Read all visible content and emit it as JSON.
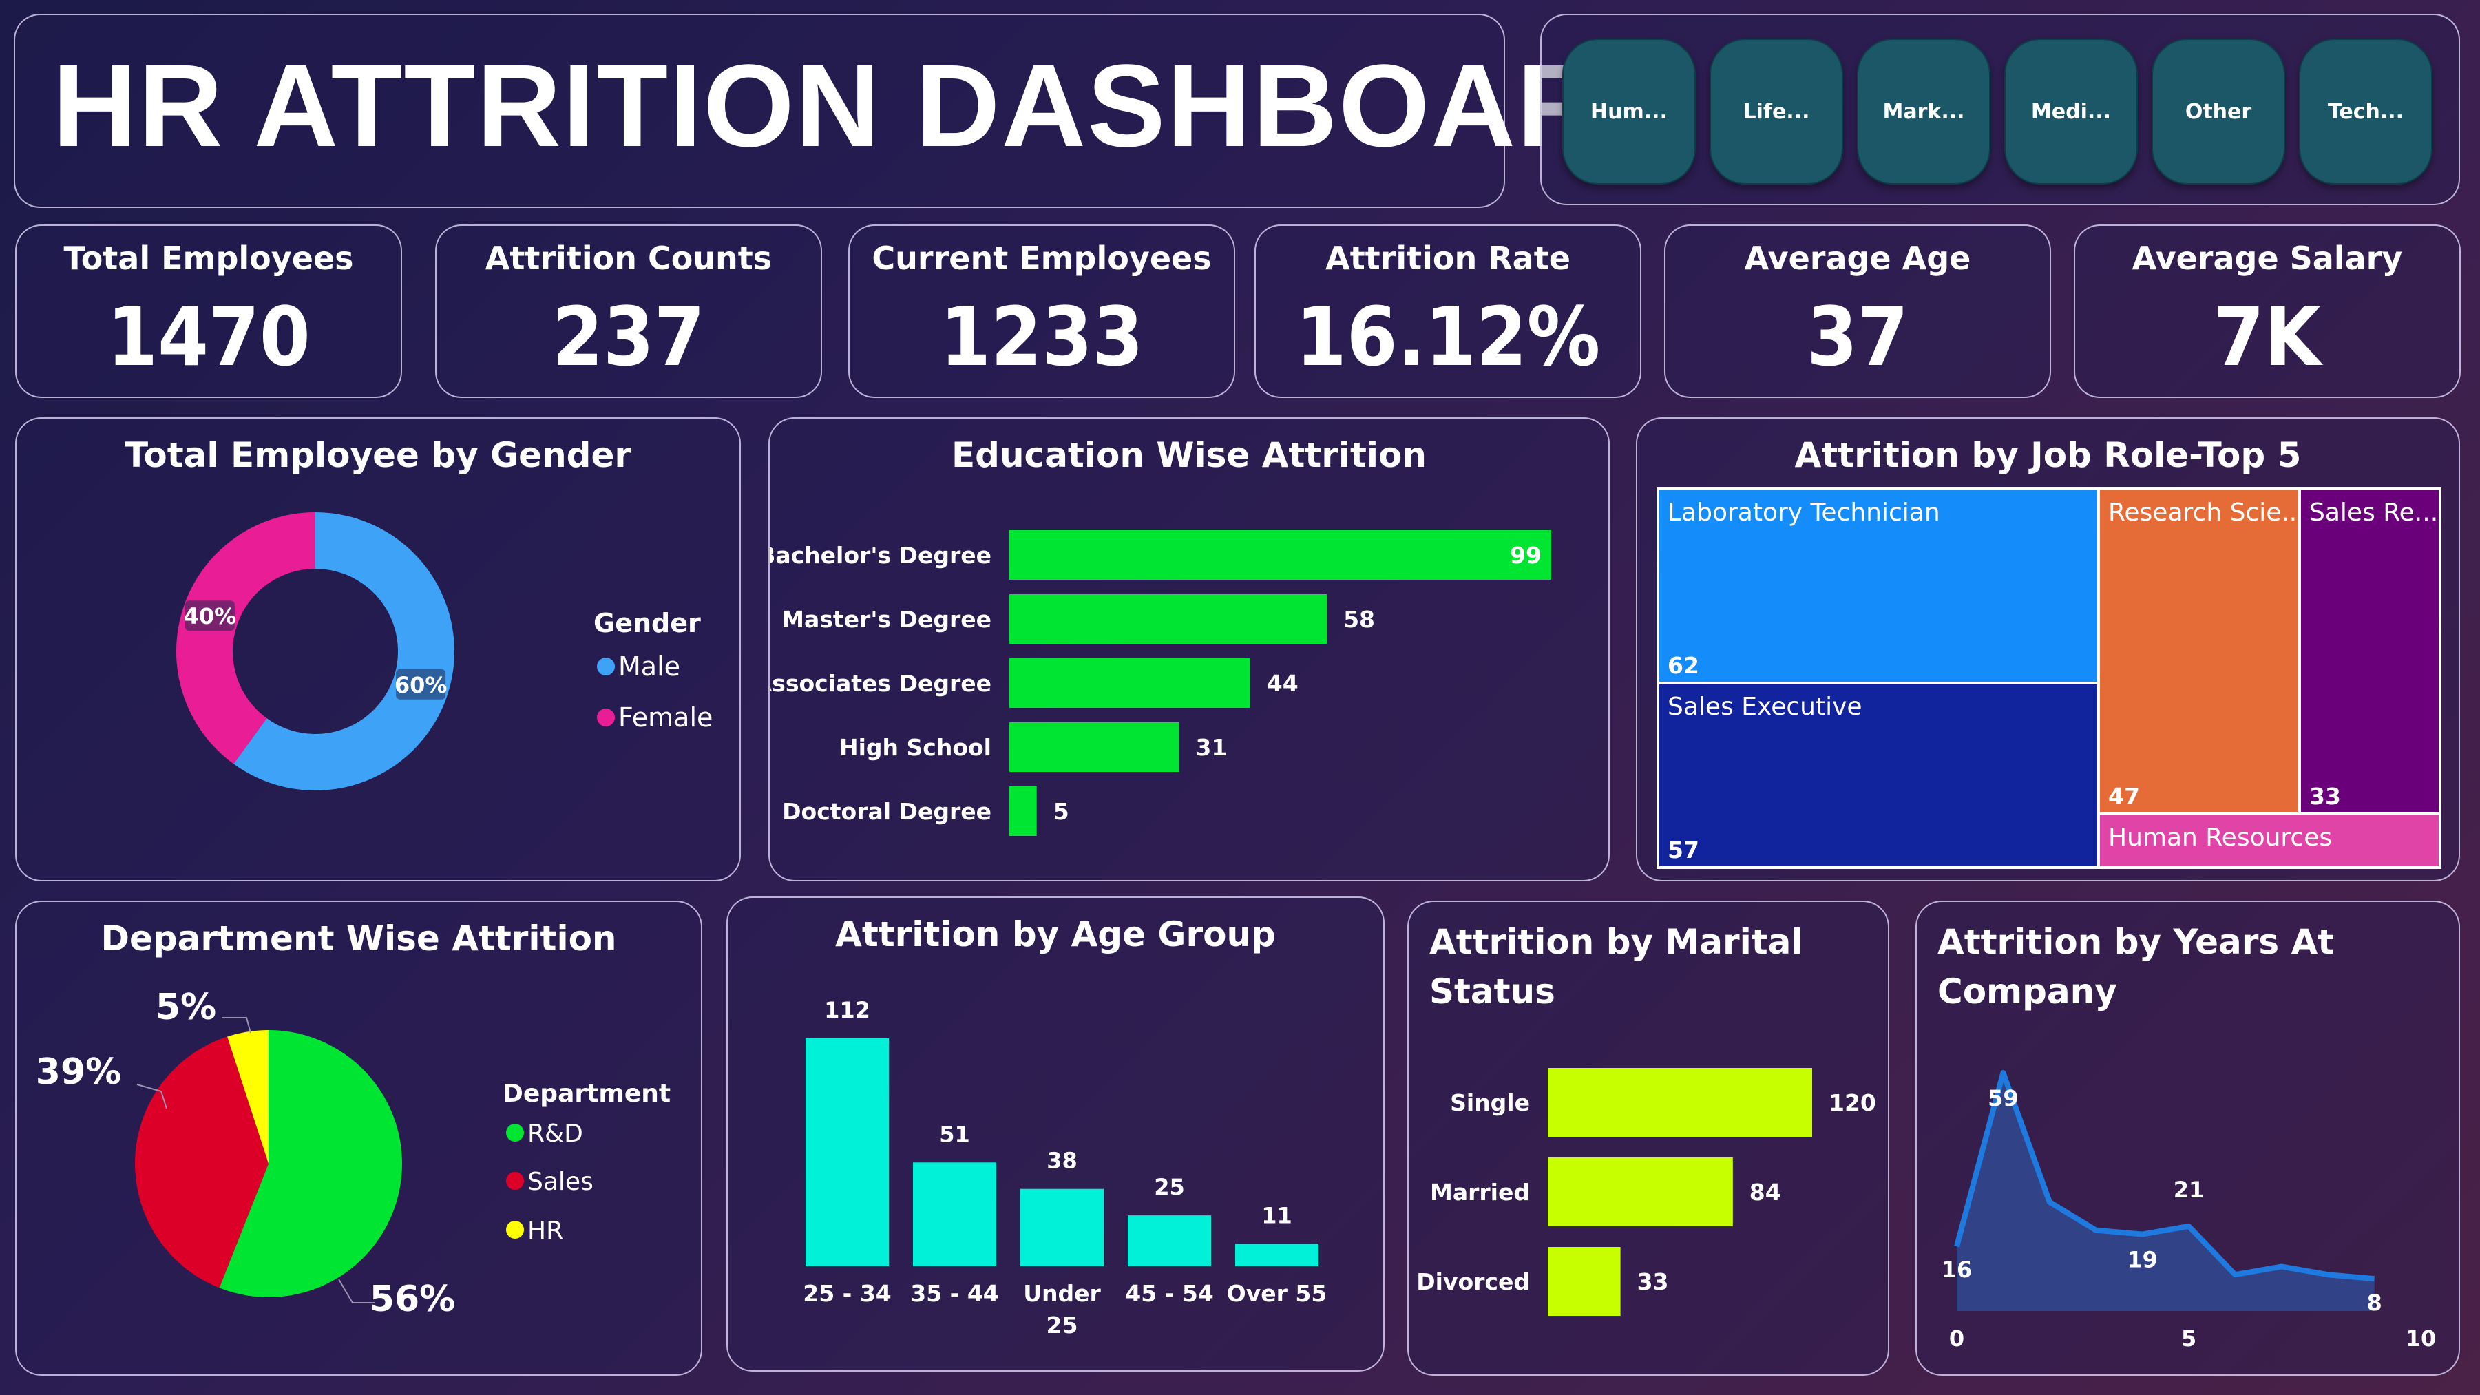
{
  "title": "HR ATTRITION DASHBOARD",
  "slicers": [
    "Hum...",
    "Life...",
    "Mark...",
    "Medi...",
    "Other",
    "Tech..."
  ],
  "kpis": [
    {
      "label": "Total Employees",
      "value": "1470"
    },
    {
      "label": "Attrition Counts",
      "value": "237"
    },
    {
      "label": "Current Employees",
      "value": "1233"
    },
    {
      "label": "Attrition Rate",
      "value": "16.12%"
    },
    {
      "label": "Average Age",
      "value": "37"
    },
    {
      "label": "Average Salary",
      "value": "7K"
    }
  ],
  "gender": {
    "title": "Total Employee by Gender",
    "legend_title": "Gender",
    "labels": {
      "male": "Male",
      "female": "Female"
    },
    "pct": {
      "male": "60%",
      "female": "40%"
    },
    "colors": {
      "male": "#3ea2f7",
      "female": "#e91e96"
    }
  },
  "education": {
    "title": "Education Wise Attrition",
    "color": "#00e532"
  },
  "jobrole": {
    "title": "Attrition by Job Role-Top 5",
    "cells": {
      "lab": {
        "label": "Laboratory Technician",
        "value": "62",
        "color": "#148cfa"
      },
      "sales_exec": {
        "label": "Sales Executive",
        "value": "57",
        "color": "#12239e"
      },
      "research": {
        "label": "Research Scie...",
        "value": "47",
        "color": "#e66c37"
      },
      "sales_rep": {
        "label": "Sales Re...",
        "value": "33",
        "color": "#6b007b"
      },
      "hr": {
        "label": "Human Resources",
        "value": "",
        "color": "#e044a7"
      }
    }
  },
  "department": {
    "title": "Department Wise Attrition",
    "legend_title": "Department",
    "labels": {
      "rd": "R&D",
      "sales": "Sales",
      "hr": "HR"
    },
    "pct": {
      "rd": "56%",
      "sales": "39%",
      "hr": "5%"
    },
    "colors": {
      "rd": "#00e532",
      "sales": "#dc0029",
      "hr": "#ffff00"
    }
  },
  "agegroup": {
    "title": "Attrition by Age Group",
    "color": "#00f0d8"
  },
  "marital": {
    "title_line1": "Attrition by Marital",
    "title_line2": "Status",
    "color": "#c8ff00"
  },
  "years": {
    "title_line1": "Attrition by Years At",
    "title_line2": "Company",
    "color": "#1f7ae0",
    "fill": "#32448a"
  },
  "chart_data": [
    {
      "type": "pie",
      "title": "Total Employee by Gender",
      "categories": [
        "Male",
        "Female"
      ],
      "values": [
        60,
        40
      ]
    },
    {
      "type": "bar",
      "title": "Education Wise Attrition",
      "orientation": "horizontal",
      "categories": [
        "Bachelor's Degree",
        "Master's Degree",
        "Associates Degree",
        "High School",
        "Doctoral Degree"
      ],
      "values": [
        99,
        58,
        44,
        31,
        5
      ]
    },
    {
      "type": "heatmap",
      "title": "Attrition by Job Role-Top 5",
      "categories": [
        "Laboratory Technician",
        "Sales Executive",
        "Research Scie...",
        "Sales Re...",
        "Human Resources"
      ],
      "values": [
        62,
        57,
        47,
        33,
        null
      ]
    },
    {
      "type": "pie",
      "title": "Department Wise Attrition",
      "categories": [
        "R&D",
        "Sales",
        "HR"
      ],
      "values": [
        56,
        39,
        5
      ]
    },
    {
      "type": "bar",
      "title": "Attrition by Age Group",
      "categories": [
        "25 - 34",
        "35 - 44",
        "Under 25",
        "45 - 54",
        "Over 55"
      ],
      "values": [
        112,
        51,
        38,
        25,
        11
      ]
    },
    {
      "type": "bar",
      "title": "Attrition by Marital Status",
      "orientation": "horizontal",
      "categories": [
        "Single",
        "Married",
        "Divorced"
      ],
      "values": [
        120,
        84,
        33
      ]
    },
    {
      "type": "area",
      "title": "Attrition by Years At Company",
      "x": [
        0,
        1,
        2,
        3,
        4,
        5,
        6,
        7,
        8,
        9
      ],
      "values": [
        16,
        59,
        27,
        20,
        19,
        21,
        9,
        11,
        9,
        8
      ],
      "xticks": [
        "0",
        "5",
        "10"
      ],
      "point_labels": {
        "0": "16",
        "1": "59",
        "4": "19",
        "5": "21",
        "9": "8"
      },
      "xlim": [
        0,
        10
      ]
    }
  ]
}
